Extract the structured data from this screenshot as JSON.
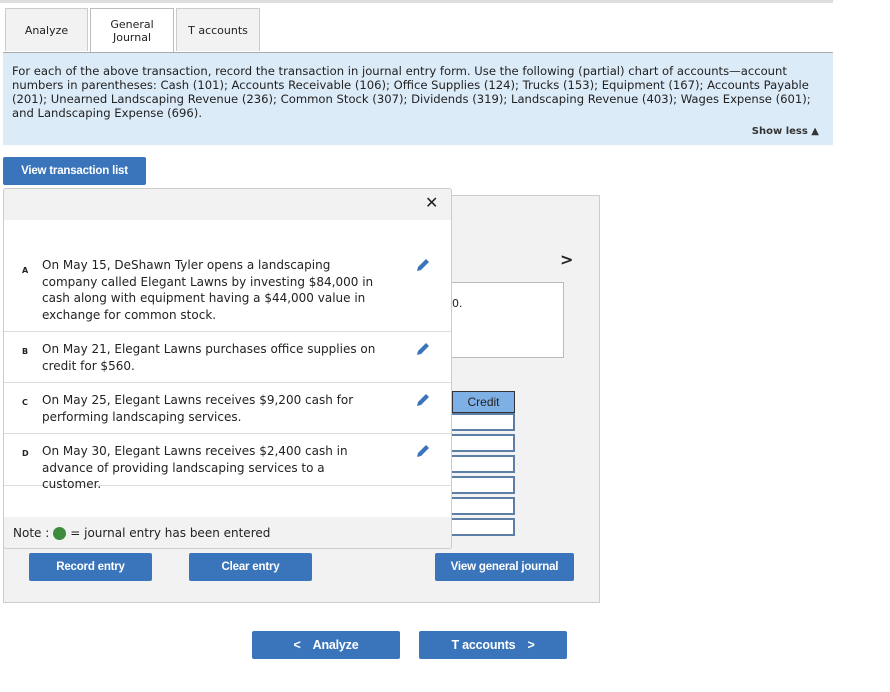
{
  "tabs": [
    {
      "label": "Analyze"
    },
    {
      "label": "General Journal"
    },
    {
      "label": "T accounts"
    }
  ],
  "instructions": "For each of the above transaction, record the transaction in journal entry form. Use the following (partial) chart of accounts—account numbers in parentheses: Cash (101); Accounts Receivable (106); Office Supplies (124); Trucks (153); Equipment (167); Accounts Payable (201); Unearned Landscaping Revenue (236); Common Stock (307); Dividends (319); Landscaping Revenue (403); Wages Expense (601); and Landscaping Expense (696).",
  "show_less": "Show less",
  "view_transaction_list": "View transaction list",
  "transactions": [
    {
      "letter": "A",
      "text": "On May 15, DeShawn Tyler opens a landscaping company called Elegant Lawns by investing $84,000 in cash along with equipment having a $44,000 value in exchange for common stock."
    },
    {
      "letter": "B",
      "text": "On May 21, Elegant Lawns purchases office supplies on credit for $560."
    },
    {
      "letter": "C",
      "text": "On May 25, Elegant Lawns receives $9,200 cash for performing landscaping services."
    },
    {
      "letter": "D",
      "text": "On May 30, Elegant Lawns receives $2,400 cash in advance of providing landscaping services to a customer."
    }
  ],
  "note_label": "Note :",
  "note_text": "= journal entry has been entered",
  "partial_text": "0.",
  "credit_header": "Credit",
  "buttons": {
    "record": "Record entry",
    "clear": "Clear entry",
    "view_journal": "View general journal"
  },
  "nav": {
    "prev": "Analyze",
    "next": "T accounts"
  },
  "colors": {
    "accent": "#3a75bb",
    "info_bg": "#dcebf8",
    "entered_dot": "#3d8b3d"
  }
}
